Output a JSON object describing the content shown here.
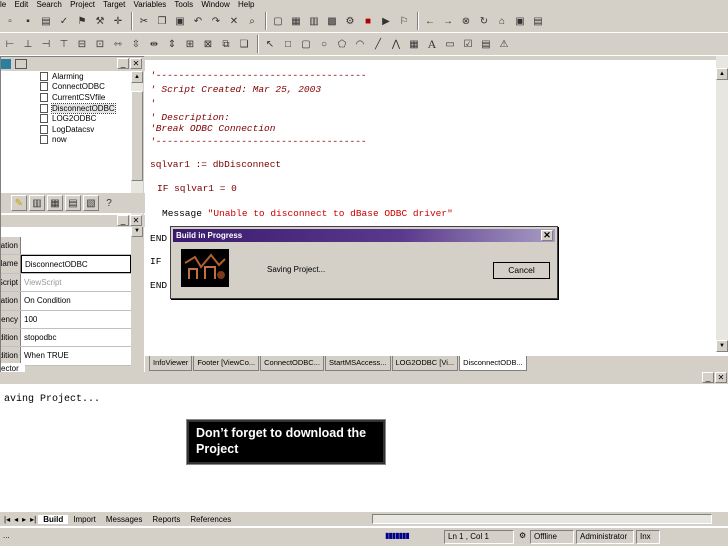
{
  "menu": [
    "le",
    "Edit",
    "Search",
    "Project",
    "Target",
    "Variables",
    "Tools",
    "Window",
    "Help"
  ],
  "tree_items": [
    {
      "label": "Alarming",
      "selected": false
    },
    {
      "label": "ConnectODBC",
      "selected": false
    },
    {
      "label": "CurrentCSVfile",
      "selected": false
    },
    {
      "label": "DisconnectODBC",
      "selected": true
    },
    {
      "label": "LOG2ODBC",
      "selected": false
    },
    {
      "label": "LogDatacsv",
      "selected": false
    },
    {
      "label": "now",
      "selected": false
    }
  ],
  "properties": [
    {
      "key": "lication",
      "value": ""
    },
    {
      "key": "Name",
      "value": "DisconnectODBC"
    },
    {
      "key": "Script",
      "value": "ViewScript"
    },
    {
      "key": "Activation",
      "value": "On Condition"
    },
    {
      "key": "Frequency",
      "value": "100"
    },
    {
      "key": "Condition",
      "value": "stopodbc"
    },
    {
      "key": "Condition",
      "value": "When TRUE"
    }
  ],
  "left_panel_footer": "ector",
  "editor": {
    "lines": [
      "'-------------------------------------",
      "' Script Created: Mar 25, 2003",
      "'",
      "' Description:",
      "'Break ODBC Connection",
      "'-------------------------------------",
      "sqlvar1 := dbDisconnect",
      "IF sqlvar1 = 0",
      "Message",
      "\"Unable to disconnect to dBase ODBC driver\"",
      "END",
      "IF",
      "END"
    ]
  },
  "dialog": {
    "title": "Build in Progress",
    "message": "Saving Project...",
    "cancel_label": "Cancel"
  },
  "file_tabs": [
    "InfoViewer",
    "Footer [ViewCo...",
    "ConnectODBC...",
    "StartMSAccess...",
    "LOG2ODBC [Vi...",
    "DisconnectODB..."
  ],
  "active_file_tab": 5,
  "output": {
    "text": "aving Project...",
    "callout": "Don’t forget to download the Project"
  },
  "bottom_tabs": [
    "Build",
    "Import",
    "Messages",
    "Reports",
    "References"
  ],
  "status": {
    "left": "...",
    "position": "Ln 1 , Col 1",
    "mode": "Offline",
    "user": "Administrator",
    "lang": "Inx"
  }
}
